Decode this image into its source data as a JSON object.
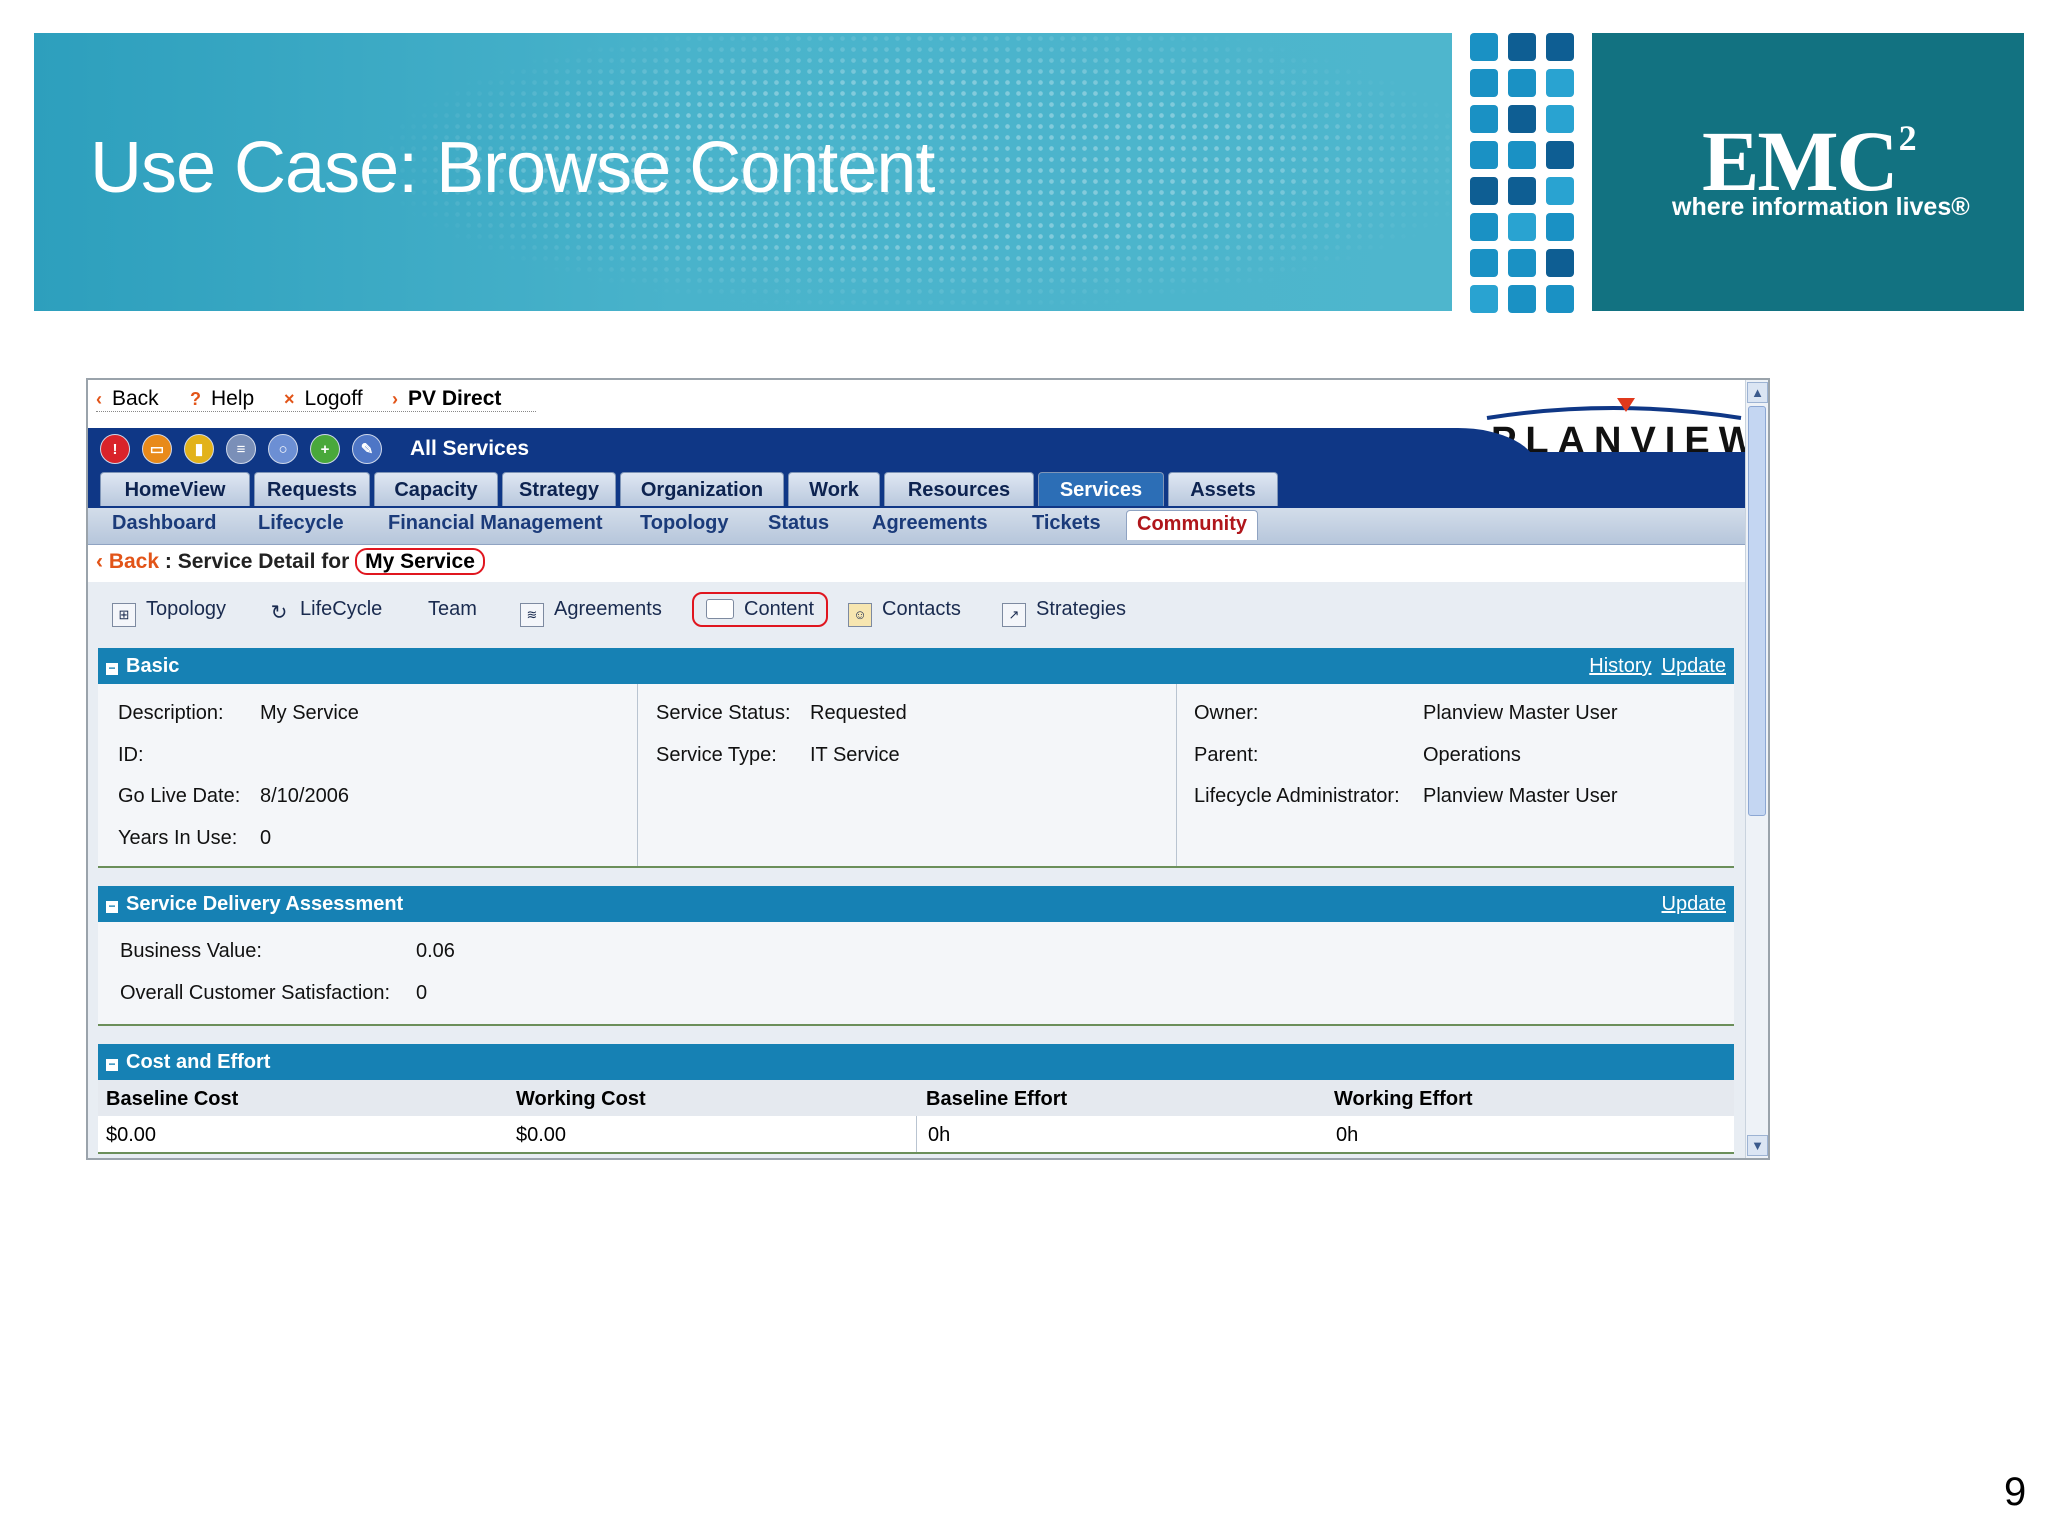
{
  "slide": {
    "title": "Use Case: Browse Content",
    "logo_word": "EMC",
    "logo_sup": "2",
    "logo_tagline": "where information lives®",
    "page_number": "9",
    "colors": {
      "banner": "#49b3cb",
      "emc_box": "#127281"
    }
  },
  "app": {
    "topnav": {
      "back": "Back",
      "help": "Help",
      "logoff": "Logoff",
      "pv_direct": "PV Direct"
    },
    "logo": "PLANVIEW",
    "toolbar_label": "All Services",
    "tabs": [
      "HomeView",
      "Requests",
      "Capacity",
      "Strategy",
      "Organization",
      "Work",
      "Resources",
      "Services",
      "Assets"
    ],
    "active_tab": "Services",
    "subtabs": [
      "Dashboard",
      "Lifecycle",
      "Financial Management",
      "Topology",
      "Status",
      "Agreements",
      "Tickets",
      "Community"
    ],
    "active_subtab": "Community",
    "breadcrumb": {
      "back": "Back",
      "label": "Service Detail for",
      "item": "My Service"
    },
    "subnav": [
      "Topology",
      "LifeCycle",
      "Team",
      "Agreements",
      "Content",
      "Contacts",
      "Strategies"
    ],
    "basic": {
      "title": "Basic",
      "links": [
        "History",
        "Update"
      ],
      "col1": [
        {
          "label": "Description:",
          "value": "My Service"
        },
        {
          "label": "ID:",
          "value": ""
        },
        {
          "label": "Go Live Date:",
          "value": "8/10/2006"
        },
        {
          "label": "Years In Use:",
          "value": "0"
        }
      ],
      "col2": [
        {
          "label": "Service Status:",
          "value": "Requested"
        },
        {
          "label": "Service Type:",
          "value": "IT Service"
        }
      ],
      "col3": [
        {
          "label": "Owner:",
          "value": "Planview Master User"
        },
        {
          "label": "Parent:",
          "value": "Operations"
        },
        {
          "label": "Lifecycle Administrator:",
          "value": "Planview Master User"
        }
      ]
    },
    "assessment": {
      "title": "Service Delivery Assessment",
      "link": "Update",
      "rows": [
        {
          "label": "Business Value:",
          "value": "0.06"
        },
        {
          "label": "Overall Customer Satisfaction:",
          "value": "0"
        }
      ]
    },
    "cost": {
      "title": "Cost and Effort",
      "headers": [
        "Baseline Cost",
        "Working Cost",
        "Baseline Effort",
        "Working Effort"
      ],
      "values": [
        "$0.00",
        "$0.00",
        "0h",
        "0h"
      ]
    }
  }
}
